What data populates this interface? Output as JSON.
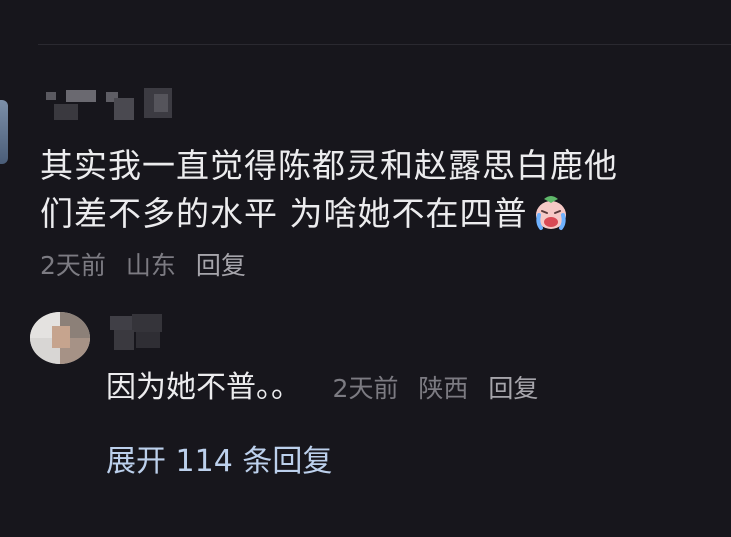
{
  "comment": {
    "text_line1": "其实我一直觉得陈都灵和赵露思白鹿他",
    "text_line2": "们差不多的水平 为啥她不在四普",
    "emoji_icon": "crying-face-emoji-icon",
    "time": "2天前",
    "location": "山东",
    "reply_label": "回复"
  },
  "reply": {
    "text": "因为她不普。。",
    "time": "2天前",
    "location": "陕西",
    "reply_label": "回复"
  },
  "expand_label": "展开 114 条回复"
}
